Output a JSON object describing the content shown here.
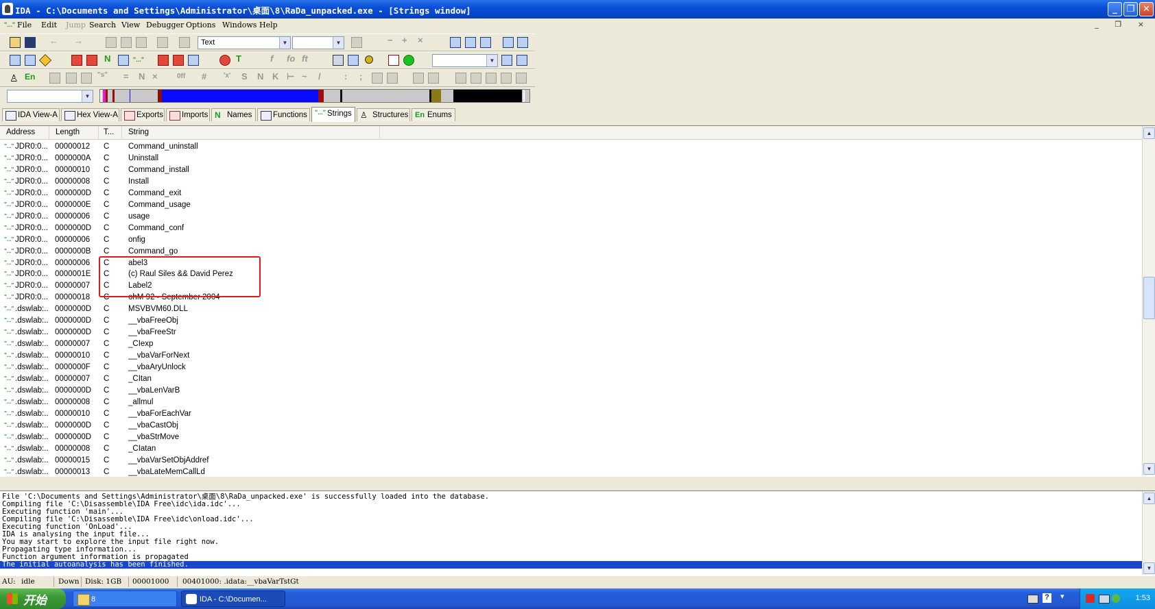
{
  "window": {
    "title": "IDA - C:\\Documents and Settings\\Administrator\\桌面\\8\\RaDa_unpacked.exe - [Strings window]",
    "controls": [
      "_",
      "❐",
      "✕"
    ]
  },
  "menu": {
    "items": [
      {
        "label": "File",
        "enabled": true
      },
      {
        "label": "Edit",
        "enabled": true
      },
      {
        "label": "Jump",
        "enabled": false
      },
      {
        "label": "Search",
        "enabled": true
      },
      {
        "label": "View",
        "enabled": true
      },
      {
        "label": "Debugger",
        "enabled": true
      },
      {
        "label": "Options",
        "enabled": true
      },
      {
        "label": "Windows",
        "enabled": true
      },
      {
        "label": "Help",
        "enabled": true
      }
    ],
    "mdi_controls": "_ ❐ ×"
  },
  "toolbar": {
    "mode_combo_value": "Text",
    "second_combo_value": "",
    "third_combo_value": "",
    "nav_combo_value": ""
  },
  "tabs": [
    {
      "label": "IDA View-A",
      "icon": "ida-view-icon",
      "active": false
    },
    {
      "label": "Hex View-A",
      "icon": "hex-view-icon",
      "active": false
    },
    {
      "label": "Exports",
      "icon": "exports-icon",
      "active": false
    },
    {
      "label": "Imports",
      "icon": "imports-icon",
      "active": false
    },
    {
      "label": "Names",
      "icon": "names-icon",
      "active": false
    },
    {
      "label": "Functions",
      "icon": "functions-icon",
      "active": false
    },
    {
      "label": "Strings",
      "icon": "strings-icon",
      "active": true
    },
    {
      "label": "Structures",
      "icon": "structures-icon",
      "active": false
    },
    {
      "label": "Enums",
      "icon": "enums-icon",
      "active": false
    }
  ],
  "strings_table": {
    "columns": [
      "Address",
      "Length",
      "T...",
      "String"
    ],
    "rows": [
      {
        "address": "JDR0:0...",
        "length": "00000012",
        "type": "C",
        "string": "Command_uninstall"
      },
      {
        "address": "JDR0:0...",
        "length": "0000000A",
        "type": "C",
        "string": "Uninstall"
      },
      {
        "address": "JDR0:0...",
        "length": "00000010",
        "type": "C",
        "string": "Command_install"
      },
      {
        "address": "JDR0:0...",
        "length": "00000008",
        "type": "C",
        "string": "Install"
      },
      {
        "address": "JDR0:0...",
        "length": "0000000D",
        "type": "C",
        "string": "Command_exit"
      },
      {
        "address": "JDR0:0...",
        "length": "0000000E",
        "type": "C",
        "string": "Command_usage"
      },
      {
        "address": "JDR0:0...",
        "length": "00000006",
        "type": "C",
        "string": "usage"
      },
      {
        "address": "JDR0:0...",
        "length": "0000000D",
        "type": "C",
        "string": "Command_conf"
      },
      {
        "address": "JDR0:0...",
        "length": "00000006",
        "type": "C",
        "string": "onfig"
      },
      {
        "address": "JDR0:0...",
        "length": "0000000B",
        "type": "C",
        "string": "Command_go"
      },
      {
        "address": "JDR0:0...",
        "length": "00000006",
        "type": "C",
        "string": "abel3"
      },
      {
        "address": "JDR0:0...",
        "length": "0000001E",
        "type": "C",
        "string": "(c) Raul Siles && David Perez"
      },
      {
        "address": "JDR0:0...",
        "length": "00000007",
        "type": "C",
        "string": "Label2"
      },
      {
        "address": "JDR0:0...",
        "length": "00000018",
        "type": "C",
        "string": "ohM 92 - September 2004"
      },
      {
        "address": ".dswlab:...",
        "length": "0000000D",
        "type": "C",
        "string": "MSVBVM60.DLL"
      },
      {
        "address": ".dswlab:...",
        "length": "0000000D",
        "type": "C",
        "string": "__vbaFreeObj"
      },
      {
        "address": ".dswlab:...",
        "length": "0000000D",
        "type": "C",
        "string": "__vbaFreeStr"
      },
      {
        "address": ".dswlab:...",
        "length": "00000007",
        "type": "C",
        "string": "_CIexp"
      },
      {
        "address": ".dswlab:...",
        "length": "00000010",
        "type": "C",
        "string": "__vbaVarForNext"
      },
      {
        "address": ".dswlab:...",
        "length": "0000000F",
        "type": "C",
        "string": "__vbaAryUnlock"
      },
      {
        "address": ".dswlab:...",
        "length": "00000007",
        "type": "C",
        "string": "_CItan"
      },
      {
        "address": ".dswlab:...",
        "length": "0000000D",
        "type": "C",
        "string": "__vbaLenVarB"
      },
      {
        "address": ".dswlab:...",
        "length": "00000008",
        "type": "C",
        "string": "_allmul"
      },
      {
        "address": ".dswlab:...",
        "length": "00000010",
        "type": "C",
        "string": "__vbaForEachVar"
      },
      {
        "address": ".dswlab:...",
        "length": "0000000D",
        "type": "C",
        "string": "__vbaCastObj"
      },
      {
        "address": ".dswlab:...",
        "length": "0000000D",
        "type": "C",
        "string": "__vbaStrMove"
      },
      {
        "address": ".dswlab:...",
        "length": "00000008",
        "type": "C",
        "string": "_CIatan"
      },
      {
        "address": ".dswlab:...",
        "length": "00000015",
        "type": "C",
        "string": "__vbaVarSetObjAddref"
      },
      {
        "address": ".dswlab:...",
        "length": "00000013",
        "type": "C",
        "string": "__vbaLateMemCallLd"
      }
    ]
  },
  "output": {
    "lines": [
      "File 'C:\\Documents and Settings\\Administrator\\桌面\\8\\RaDa_unpacked.exe' is successfully loaded into the database.",
      "Compiling file 'C:\\Disassemble\\IDA Free\\idc\\ida.idc'...",
      "Executing function 'main'...",
      "Compiling file 'C:\\Disassemble\\IDA Free\\idc\\onload.idc'...",
      "Executing function 'OnLoad'...",
      "IDA is analysing the input file...",
      "You may start to explore the input file right now.",
      "Propagating type information...",
      "Function argument information is propagated",
      "The initial autoanalysis has been finished."
    ],
    "selected_index": 9
  },
  "statusbar": {
    "au": "AU:",
    "state": "idle",
    "direction": "Down",
    "disk": "Disk: 1GB",
    "offset": "00001000",
    "location": "00401000: .idata:__vbaVarTstGt"
  },
  "taskbar": {
    "start_label": "开始",
    "tasks": [
      {
        "label": "8",
        "icon": "folder-icon"
      },
      {
        "label": "IDA - C:\\Documen...",
        "icon": "ida-app-icon"
      }
    ],
    "clock": "1:53"
  }
}
